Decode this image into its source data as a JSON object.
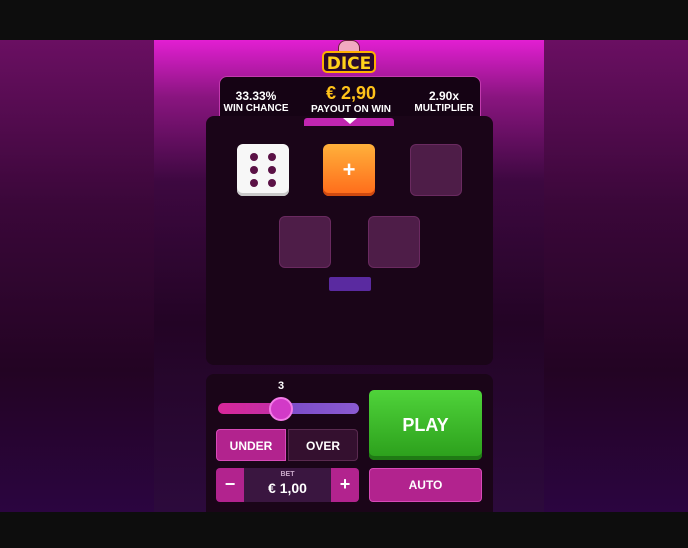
{
  "logo": {
    "text": "DICE"
  },
  "stats": {
    "win_chance_value": "33.33%",
    "win_chance_label": "WIN CHANCE",
    "payout_value": "€ 2,90",
    "payout_label": "PAYOUT ON WIN",
    "multiplier_value": "2.90x",
    "multiplier_label": "MULTIPLIER"
  },
  "board": {
    "rolled_die": {
      "face": 6
    },
    "add_button_symbol": "+",
    "empty_slots": 3
  },
  "controls": {
    "slider": {
      "value": "3"
    },
    "under_label": "UNDER",
    "over_label": "OVER",
    "selected_mode": "UNDER",
    "bet": {
      "label": "BET",
      "value": "€ 1,00",
      "minus_symbol": "−",
      "plus_symbol": "+"
    },
    "play_label": "PLAY",
    "auto_label": "AUTO"
  },
  "colors": {
    "accent": "#b2238e",
    "payout": "#ffc21a",
    "play": "#3cbf2a",
    "add_die": "#ff8a2a"
  }
}
